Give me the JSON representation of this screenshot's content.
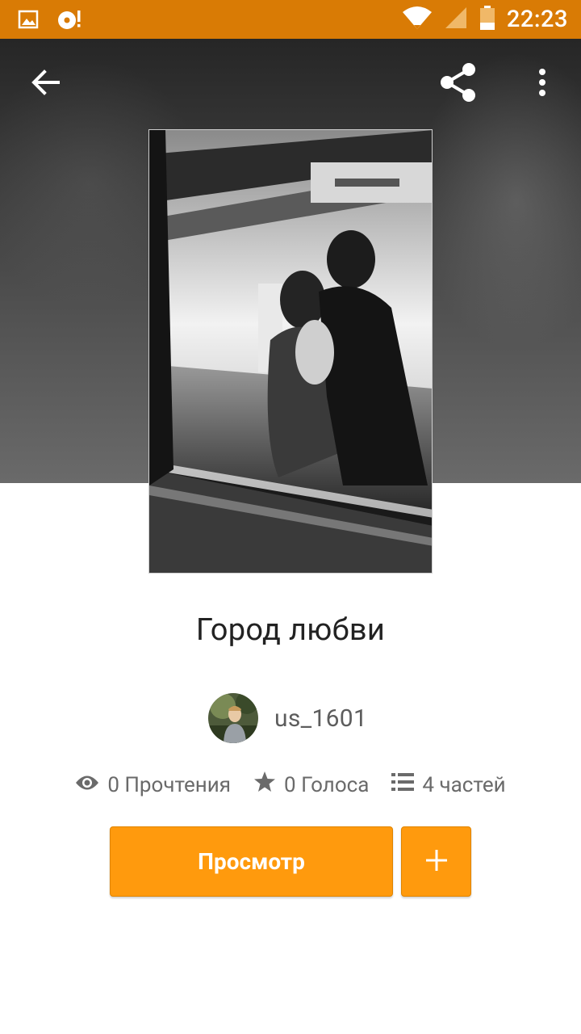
{
  "status_bar": {
    "time": "22:23",
    "icons": [
      "image-notification-icon",
      "download-notification-icon",
      "wifi-icon",
      "signal-icon",
      "battery-icon"
    ]
  },
  "toolbar": {
    "icons": [
      "back-arrow-icon",
      "share-icon",
      "more-vert-icon"
    ]
  },
  "story": {
    "title": "Город любви",
    "author": "us_1601",
    "reads_label": "0 Прочтения",
    "votes_label": "0 Голоса",
    "parts_label": "4 частей"
  },
  "actions": {
    "read_label": "Просмотр",
    "add_icon": "plus-icon"
  },
  "colors": {
    "status_bar": "#d97b05",
    "accent": "#ff9a0d"
  }
}
